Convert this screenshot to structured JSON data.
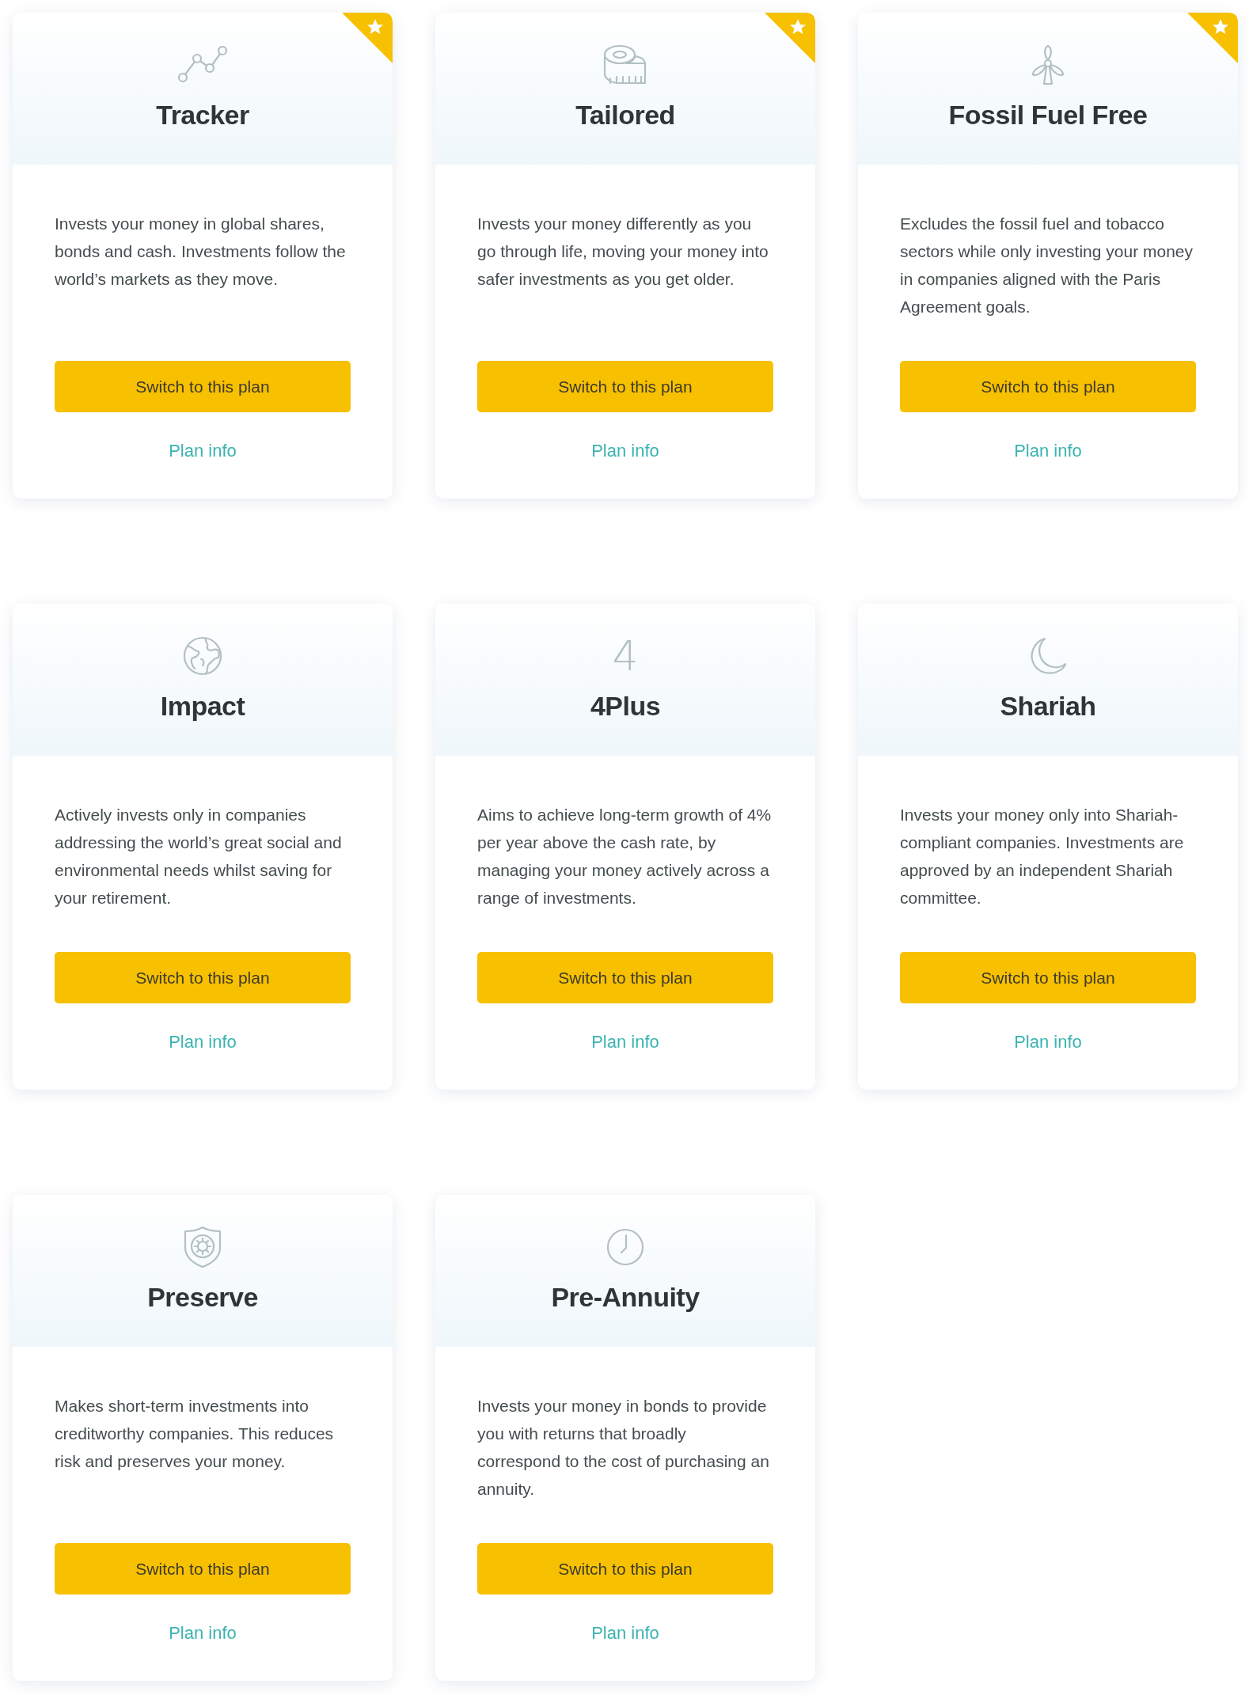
{
  "plans": [
    {
      "title": "Tracker",
      "kind": "chart",
      "featured": true,
      "description": "Invests your money in global shares, bonds and cash. Investments follow the world’s markets as they move.",
      "button": "Switch to this plan",
      "link": "Plan info"
    },
    {
      "title": "Tailored",
      "kind": "tape",
      "featured": true,
      "description": "Invests your money differently as you go through life, moving your money into safer investments as you get older.",
      "button": "Switch to this plan",
      "link": "Plan info"
    },
    {
      "title": "Fossil Fuel Free",
      "kind": "windmill",
      "featured": true,
      "description": "Excludes the fossil fuel and tobacco sectors while only investing your money in companies aligned with the Paris Agreement goals.",
      "button": "Switch to this plan",
      "link": "Plan info"
    },
    {
      "title": "Impact",
      "kind": "globe",
      "featured": false,
      "description": "Actively invests only in companies addressing the world’s great social and environmental needs whilst saving for your retirement.",
      "button": "Switch to this plan",
      "link": "Plan info"
    },
    {
      "title": "4Plus",
      "kind": "glyph",
      "glyph": "4",
      "featured": false,
      "description": "Aims to achieve long-term growth of 4% per year above the cash rate, by managing your money actively across a range of investments.",
      "button": "Switch to this plan",
      "link": "Plan info"
    },
    {
      "title": "Shariah",
      "kind": "moon",
      "featured": false,
      "description": "Invests your money only into Shariah-compliant companies. Investments are approved by an independent Shariah committee.",
      "button": "Switch to this plan",
      "link": "Plan info"
    },
    {
      "title": "Preserve",
      "kind": "shield",
      "featured": false,
      "description": "Makes short-term investments into creditworthy companies. This reduces risk and preserves your money.",
      "button": "Switch to this plan",
      "link": "Plan info"
    },
    {
      "title": "Pre-Annuity",
      "kind": "clock",
      "featured": false,
      "description": "Invests your money in bonds to provide you with returns that broadly correspond to the cost of purchasing an annuity.",
      "button": "Switch to this plan",
      "link": "Plan info"
    }
  ]
}
